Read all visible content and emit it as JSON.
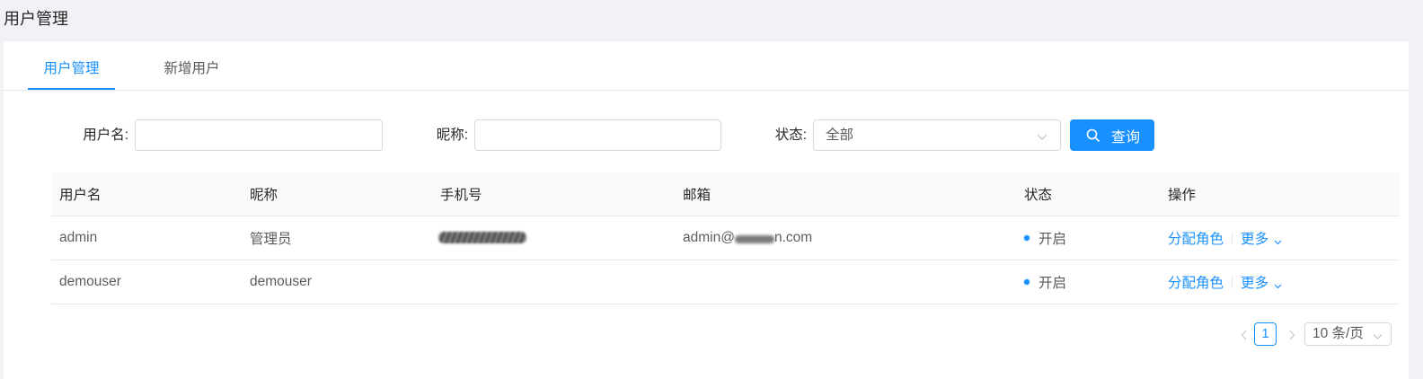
{
  "header": {
    "title": "用户管理"
  },
  "tabs": [
    {
      "label": "用户管理",
      "active": true
    },
    {
      "label": "新增用户",
      "active": false
    }
  ],
  "search": {
    "username": {
      "label": "用户名:",
      "value": ""
    },
    "nickname": {
      "label": "昵称:",
      "value": ""
    },
    "status": {
      "label": "状态:",
      "selected": "全部"
    },
    "query_button": {
      "label": "查询",
      "icon": "search-icon"
    }
  },
  "table": {
    "columns": [
      "用户名",
      "昵称",
      "手机号",
      "邮箱",
      "状态",
      "操作"
    ],
    "rows": [
      {
        "username": "admin",
        "nickname": "管理员",
        "phone_redacted": true,
        "email_prefix": "admin@",
        "email_suffix": "n.com",
        "email_redacted": true,
        "status": "开启",
        "actions": {
          "assign_role": "分配角色",
          "more": "更多"
        }
      },
      {
        "username": "demouser",
        "nickname": "demouser",
        "phone": "",
        "email": "",
        "status": "开启",
        "actions": {
          "assign_role": "分配角色",
          "more": "更多"
        }
      }
    ]
  },
  "pagination": {
    "current_page": "1",
    "page_size": "10 条/页"
  },
  "colors": {
    "accent": "#1890ff",
    "status_on": "#1890ff",
    "page_background": "#f0f2f5"
  }
}
